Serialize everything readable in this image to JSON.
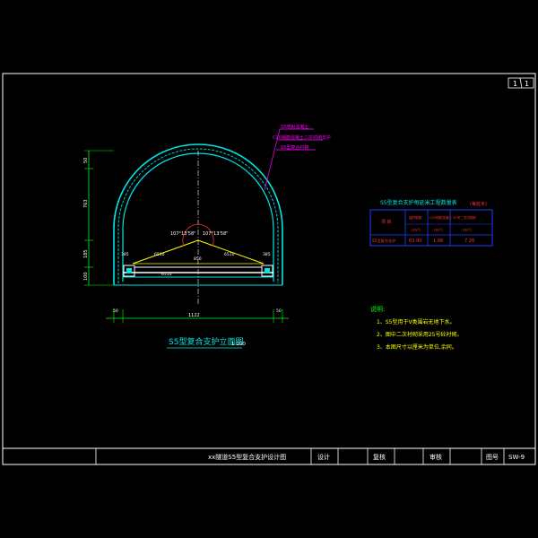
{
  "sheet": {
    "page": "1",
    "total": "1"
  },
  "drawing_title": "S5型复合支护立面图",
  "drawing_scale": "1:100",
  "dims": {
    "width_total": "1122",
    "width_left": "50",
    "width_right": "50",
    "h_top": "50",
    "h_main": "763",
    "h_lower": "185",
    "h_bottom": "100",
    "angle_left": "107°13'58\"",
    "angle_right": "107°13'58\"",
    "center_mark": "850",
    "chord_left": "6510",
    "chord_right": "6510",
    "base_left": "6510",
    "side_left": "385",
    "side_right": "385"
  },
  "layer_labels": [
    "S5喷射混凝土",
    "C20钢筋混凝土二次衬砌支护",
    "S5型复合衬砌"
  ],
  "quantity_table": {
    "title": "S5型复合支护每延米工程数量表",
    "unit_note": "(每延米)",
    "headers": [
      "项 目",
      "锚杆钢筋",
      "C20喷射混凝土",
      "25号二次衬砌砼"
    ],
    "units": [
      "",
      "(m³)",
      "(m³)",
      "(m³)"
    ],
    "rows": [
      {
        "item": "S5型复合支护",
        "v1": "63.90",
        "v2": "1.98",
        "v3": "7.26"
      }
    ]
  },
  "notes": {
    "heading": "说明:",
    "items": [
      "1、S5型用于Ⅴ类围岩无地下水。",
      "2、图中二次衬砌采用25号砼衬砌。",
      "3、本图尺寸以厘米为单位,余同。"
    ]
  },
  "title_block": {
    "name": "xx隧道S5型复合支护设计图",
    "design": "设计",
    "review": "复核",
    "approve": "审核",
    "drawing_no_label": "图号",
    "drawing_no": "SW-9"
  },
  "colors": {
    "frame": "#ffffff",
    "lining": "#00e5e5",
    "dim": "#00ff00",
    "text_yellow": "#ffff00",
    "table_red": "#ff3030",
    "label_magenta": "#ff00ff",
    "table_blue": "#2040ff"
  }
}
